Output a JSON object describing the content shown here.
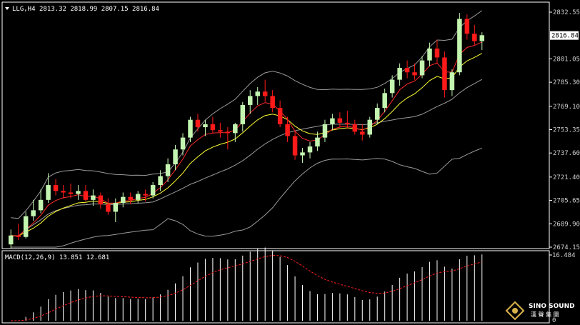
{
  "header": {
    "symbol_tf": "LLG,H4",
    "ohlc": "2813.32 2818.99 2807.15 2816.84"
  },
  "price_axis": {
    "ticks": [
      "2832.55",
      "2816.84",
      "2801.05",
      "2785.30",
      "2769.10",
      "2753.35",
      "2737.60",
      "2721.40",
      "2705.65",
      "2689.90",
      "2674.15"
    ],
    "current_price": "2816.84"
  },
  "macd_panel": {
    "label": "MACD(12,26,9) 13.851 12.681",
    "axis_top": "16.484",
    "axis_zero": "0"
  },
  "watermark": {
    "brand": "SINO SOUND",
    "sub": "漢 聲 集 團"
  },
  "colors": {
    "background": "#000000",
    "bull_candle": "#c3f5b0",
    "bear_candle": "#ff1a1a",
    "bollinger": "#9a9a9a",
    "ma_fast": "#ff2a2a",
    "ma_slow": "#ffff33",
    "macd_hist": "#ffffff",
    "macd_signal": "#ff2020",
    "grid_border": "#ffffff"
  },
  "chart_data": [
    {
      "type": "candlestick",
      "title": "LLG,H4",
      "ylim": [
        2674.15,
        2832.55
      ],
      "ohlc": [
        [
          2676,
          2686,
          2673,
          2682
        ],
        [
          2682,
          2690,
          2679,
          2681
        ],
        [
          2681,
          2698,
          2680,
          2695
        ],
        [
          2695,
          2706,
          2692,
          2699
        ],
        [
          2699,
          2713,
          2697,
          2706
        ],
        [
          2706,
          2724,
          2704,
          2716
        ],
        [
          2716,
          2720,
          2709,
          2712
        ],
        [
          2712,
          2716,
          2707,
          2711
        ],
        [
          2711,
          2717,
          2707,
          2710
        ],
        [
          2710,
          2716,
          2706,
          2712
        ],
        [
          2712,
          2716,
          2705,
          2706
        ],
        [
          2706,
          2713,
          2702,
          2709
        ],
        [
          2709,
          2711,
          2700,
          2703
        ],
        [
          2703,
          2707,
          2696,
          2698
        ],
        [
          2698,
          2707,
          2691,
          2704
        ],
        [
          2704,
          2711,
          2701,
          2708
        ],
        [
          2708,
          2711,
          2703,
          2706
        ],
        [
          2706,
          2712,
          2704,
          2710
        ],
        [
          2710,
          2713,
          2705,
          2709
        ],
        [
          2709,
          2718,
          2707,
          2716
        ],
        [
          2716,
          2726,
          2712,
          2722
        ],
        [
          2722,
          2734,
          2718,
          2730
        ],
        [
          2730,
          2743,
          2726,
          2740
        ],
        [
          2740,
          2751,
          2736,
          2748
        ],
        [
          2748,
          2762,
          2745,
          2760
        ],
        [
          2760,
          2764,
          2752,
          2755
        ],
        [
          2755,
          2760,
          2749,
          2757
        ],
        [
          2757,
          2762,
          2751,
          2753
        ],
        [
          2753,
          2758,
          2748,
          2752
        ],
        [
          2752,
          2755,
          2740,
          2751
        ],
        [
          2751,
          2758,
          2745,
          2757
        ],
        [
          2757,
          2772,
          2752,
          2770
        ],
        [
          2770,
          2780,
          2764,
          2776
        ],
        [
          2776,
          2782,
          2770,
          2779
        ],
        [
          2779,
          2787,
          2772,
          2776
        ],
        [
          2776,
          2780,
          2765,
          2768
        ],
        [
          2768,
          2773,
          2755,
          2757
        ],
        [
          2757,
          2762,
          2745,
          2749
        ],
        [
          2749,
          2753,
          2733,
          2736
        ],
        [
          2736,
          2741,
          2731,
          2738
        ],
        [
          2738,
          2745,
          2734,
          2742
        ],
        [
          2742,
          2752,
          2739,
          2748
        ],
        [
          2748,
          2760,
          2745,
          2757
        ],
        [
          2757,
          2764,
          2753,
          2761
        ],
        [
          2761,
          2765,
          2755,
          2758
        ],
        [
          2758,
          2766,
          2754,
          2757
        ],
        [
          2757,
          2760,
          2750,
          2752
        ],
        [
          2752,
          2757,
          2746,
          2750
        ],
        [
          2750,
          2762,
          2748,
          2760
        ],
        [
          2760,
          2771,
          2757,
          2768
        ],
        [
          2768,
          2781,
          2765,
          2778
        ],
        [
          2778,
          2790,
          2775,
          2787
        ],
        [
          2787,
          2798,
          2783,
          2795
        ],
        [
          2795,
          2800,
          2788,
          2792
        ],
        [
          2792,
          2798,
          2787,
          2790
        ],
        [
          2790,
          2803,
          2788,
          2800
        ],
        [
          2800,
          2812,
          2796,
          2808
        ],
        [
          2808,
          2814,
          2798,
          2802
        ],
        [
          2802,
          2806,
          2775,
          2780
        ],
        [
          2780,
          2794,
          2776,
          2792
        ],
        [
          2792,
          2832,
          2790,
          2828
        ],
        [
          2828,
          2831,
          2814,
          2818
        ],
        [
          2818,
          2824,
          2810,
          2813
        ],
        [
          2813,
          2819,
          2807,
          2817
        ]
      ]
    },
    {
      "type": "macd",
      "title": "MACD(12,26,9)",
      "params": [
        12,
        26,
        9
      ],
      "macd_value": 13.851,
      "signal_value": 12.681,
      "ylim": [
        0,
        16.484
      ]
    }
  ]
}
